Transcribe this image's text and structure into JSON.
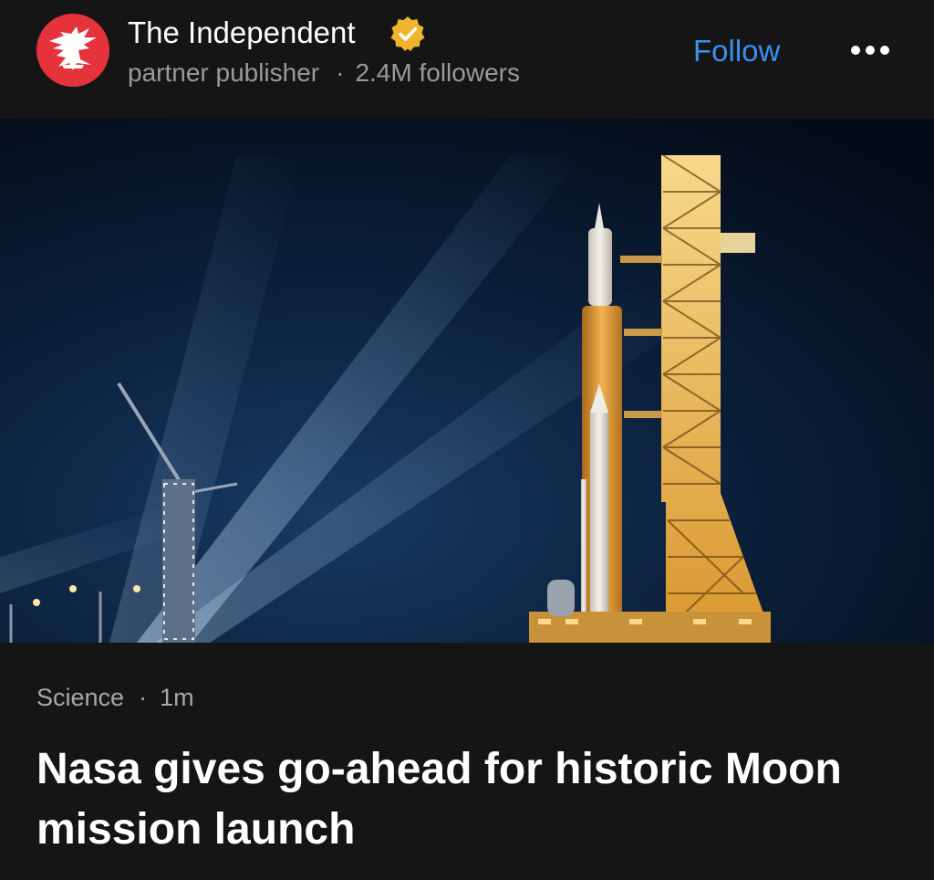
{
  "publisher": {
    "name": "The Independent",
    "subtitle": "partner publisher",
    "separator": "·",
    "followers": "2.4M followers",
    "verified": true,
    "avatar_icon": "eagle-icon",
    "avatar_color": "#e5333b",
    "verified_color": "#f0b42d"
  },
  "actions": {
    "follow_label": "Follow",
    "more_icon": "more-horizontal-icon",
    "follow_color": "#3b8ff0"
  },
  "article": {
    "category": "Science",
    "separator": "·",
    "time_ago": "1m",
    "headline": "Nasa gives go-ahead for historic Moon mission launch"
  }
}
